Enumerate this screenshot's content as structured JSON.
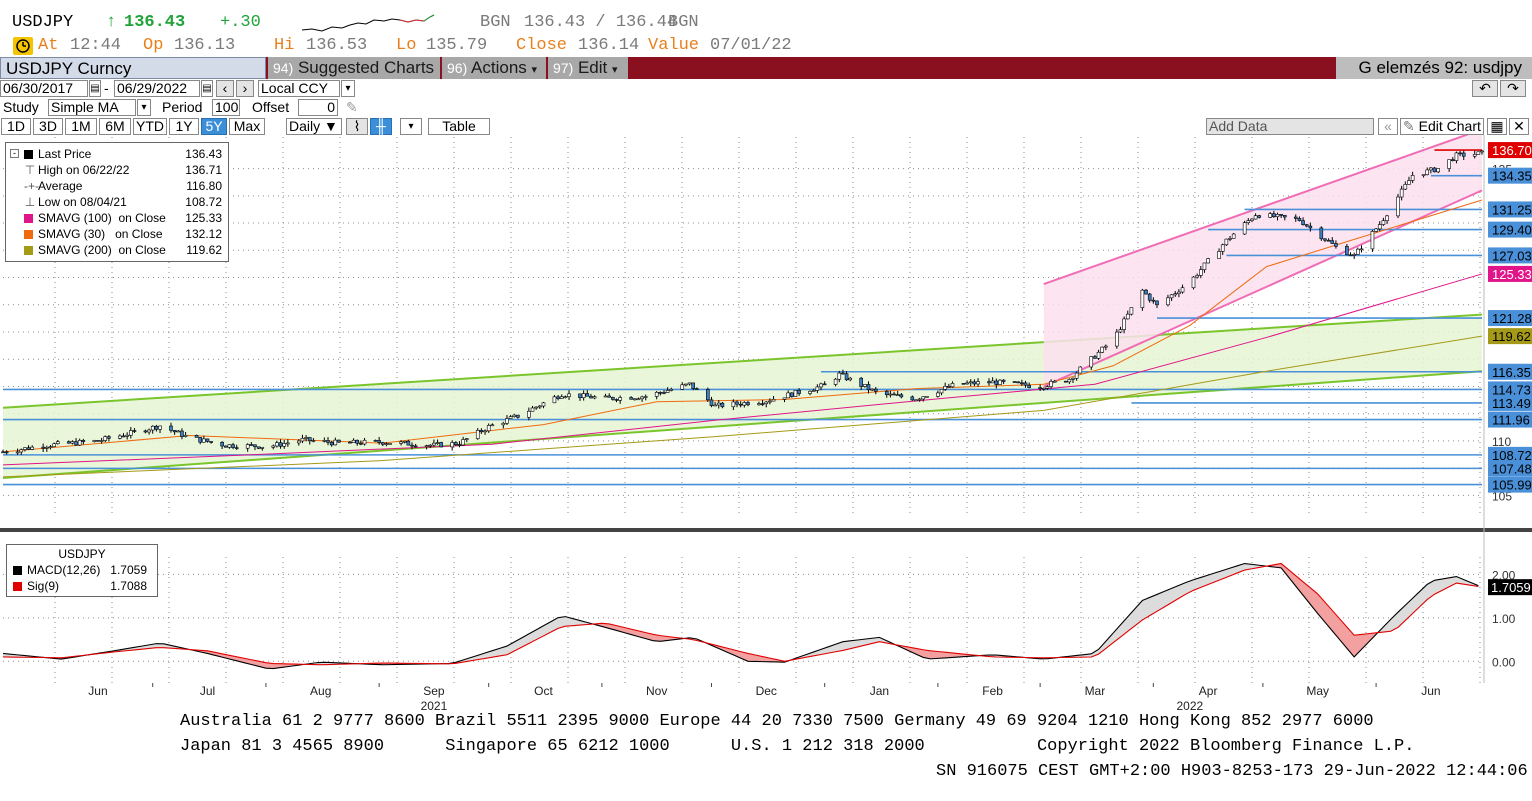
{
  "quote": {
    "ticker": "USDJPY",
    "arrow": "↑",
    "last": "136.43",
    "change": "+.30",
    "bid_label": "BGN",
    "bid_ask": "136.43 / 136.44",
    "ask_label": "BGN",
    "at_label": "At",
    "at_value": "12:44",
    "op_label": "Op",
    "op_value": "136.13",
    "hi_label": "Hi",
    "hi_value": "136.53",
    "lo_label": "Lo",
    "lo_value": "135.79",
    "close_label": "Close",
    "close_value": "136.14",
    "value_label": "Value",
    "value_date": "07/01/22"
  },
  "toolbar": {
    "security": "USDJPY Curncy",
    "suggested_num": "94)",
    "suggested_label": "Suggested Charts",
    "actions_num": "96)",
    "actions_label": "Actions",
    "edit_num": "97)",
    "edit_label": "Edit",
    "title_right": "G elemzés 92: usdjpy"
  },
  "range": {
    "start": "06/30/2017",
    "sep": "-",
    "end": "06/29/2022",
    "currency": "Local CCY"
  },
  "study": {
    "label": "Study",
    "type": "Simple MA",
    "period_label": "Period",
    "period": "100",
    "offset_label": "Offset",
    "offset": "0"
  },
  "periods": {
    "buttons": [
      "1D",
      "3D",
      "1M",
      "6M",
      "YTD",
      "1Y",
      "5Y",
      "Max"
    ],
    "selected": "5Y",
    "frequency": "Daily ▼",
    "table_label": "Table",
    "add_data_placeholder": "Add Data",
    "edit_chart_label": "Edit Chart"
  },
  "legend_price": [
    {
      "label": "Last Price",
      "value": "136.43",
      "color": "#000000",
      "glyph": ""
    },
    {
      "label": "High on 06/22/22",
      "value": "136.71",
      "color": "",
      "glyph": "⊤"
    },
    {
      "label": "Average",
      "value": "116.80",
      "color": "",
      "glyph": "-+-"
    },
    {
      "label": "Low on 08/04/21",
      "value": "108.72",
      "color": "",
      "glyph": "⊥"
    },
    {
      "label": "SMAVG (100)  on Close",
      "value": "125.33",
      "color": "#e0158a",
      "glyph": ""
    },
    {
      "label": "SMAVG (30)   on Close",
      "value": "132.12",
      "color": "#ef6a10",
      "glyph": ""
    },
    {
      "label": "SMAVG (200)  on Close",
      "value": "119.62",
      "color": "#a59a18",
      "glyph": ""
    }
  ],
  "legend_macd": {
    "title": "USDJPY",
    "items": [
      {
        "label": "MACD(12,26)",
        "value": "1.7059",
        "color": "#000000"
      },
      {
        "label": "Sig(9)",
        "value": "1.7088",
        "color": "#e00000"
      }
    ]
  },
  "chart_data": [
    {
      "type": "candlestick",
      "title": "",
      "x_start": "2021-05-20",
      "x_end": "2022-06-29",
      "x_tick_labels": [
        {
          "label": "Jun",
          "date": "2021-06-15"
        },
        {
          "label": "Jul",
          "date": "2021-07-15"
        },
        {
          "label": "Aug",
          "date": "2021-08-15"
        },
        {
          "label": "Sep",
          "date": "2021-09-15"
        },
        {
          "label": "Oct",
          "date": "2021-10-15"
        },
        {
          "label": "Nov",
          "date": "2021-11-15"
        },
        {
          "label": "Dec",
          "date": "2021-12-15"
        },
        {
          "label": "Jan",
          "date": "2022-01-15"
        },
        {
          "label": "Feb",
          "date": "2022-02-15"
        },
        {
          "label": "Mar",
          "date": "2022-03-15"
        },
        {
          "label": "Apr",
          "date": "2022-04-15"
        },
        {
          "label": "May",
          "date": "2022-05-15"
        },
        {
          "label": "Jun",
          "date": "2022-06-15"
        }
      ],
      "year_labels": [
        {
          "label": "2021",
          "date": "2021-09-15"
        },
        {
          "label": "2022",
          "date": "2022-04-10"
        }
      ],
      "ylim": [
        103.2,
        137.9
      ],
      "y_ticks": [
        105,
        110,
        135
      ],
      "grid": true,
      "price_path": [
        [
          "2021-05-20",
          109.0
        ],
        [
          "2021-06-01",
          109.6
        ],
        [
          "2021-06-15",
          110.0
        ],
        [
          "2021-06-25",
          110.8
        ],
        [
          "2021-07-02",
          111.4
        ],
        [
          "2021-07-10",
          110.3
        ],
        [
          "2021-07-20",
          109.6
        ],
        [
          "2021-08-01",
          109.5
        ],
        [
          "2021-08-10",
          110.1
        ],
        [
          "2021-08-20",
          109.8
        ],
        [
          "2021-09-01",
          109.9
        ],
        [
          "2021-09-15",
          109.6
        ],
        [
          "2021-09-22",
          109.8
        ],
        [
          "2021-09-30",
          111.3
        ],
        [
          "2021-10-08",
          112.3
        ],
        [
          "2021-10-20",
          114.3
        ],
        [
          "2021-11-01",
          113.9
        ],
        [
          "2021-11-12",
          114.1
        ],
        [
          "2021-11-24",
          115.2
        ],
        [
          "2021-12-01",
          113.2
        ],
        [
          "2021-12-15",
          113.7
        ],
        [
          "2021-12-31",
          115.1
        ],
        [
          "2022-01-04",
          116.1
        ],
        [
          "2022-01-15",
          114.3
        ],
        [
          "2022-01-25",
          113.9
        ],
        [
          "2022-02-05",
          115.2
        ],
        [
          "2022-02-15",
          115.4
        ],
        [
          "2022-02-28",
          115.0
        ],
        [
          "2022-03-08",
          115.7
        ],
        [
          "2022-03-20",
          119.3
        ],
        [
          "2022-03-28",
          123.8
        ],
        [
          "2022-04-01",
          122.4
        ],
        [
          "2022-04-10",
          124.6
        ],
        [
          "2022-04-20",
          128.4
        ],
        [
          "2022-04-28",
          130.8
        ],
        [
          "2022-05-10",
          130.3
        ],
        [
          "2022-05-20",
          127.8
        ],
        [
          "2022-05-25",
          127.0
        ],
        [
          "2022-06-01",
          129.9
        ],
        [
          "2022-06-10",
          134.4
        ],
        [
          "2022-06-17",
          135.0
        ],
        [
          "2022-06-22",
          136.2
        ],
        [
          "2022-06-29",
          136.4
        ]
      ],
      "series": [
        {
          "name": "SMAVG (30)",
          "values": [
            [
              "2021-05-20",
              109.0
            ],
            [
              "2021-07-10",
              110.5
            ],
            [
              "2021-09-01",
              109.8
            ],
            [
              "2021-10-15",
              111.5
            ],
            [
              "2021-11-15",
              113.6
            ],
            [
              "2021-12-20",
              113.8
            ],
            [
              "2022-01-25",
              114.8
            ],
            [
              "2022-03-01",
              115.2
            ],
            [
              "2022-03-20",
              116.9
            ],
            [
              "2022-04-10",
              120.6
            ],
            [
              "2022-05-01",
              126.0
            ],
            [
              "2022-05-25",
              128.5
            ],
            [
              "2022-06-29",
              132.12
            ]
          ]
        },
        {
          "name": "SMAVG (100)",
          "values": [
            [
              "2021-05-20",
              107.8
            ],
            [
              "2021-08-01",
              108.8
            ],
            [
              "2021-10-01",
              109.7
            ],
            [
              "2021-12-01",
              111.9
            ],
            [
              "2022-02-01",
              113.9
            ],
            [
              "2022-03-15",
              115.2
            ],
            [
              "2022-05-01",
              119.5
            ],
            [
              "2022-06-29",
              125.33
            ]
          ]
        },
        {
          "name": "SMAVG (200)",
          "values": [
            [
              "2021-05-20",
              106.7
            ],
            [
              "2021-09-01",
              108.2
            ],
            [
              "2021-12-01",
              110.4
            ],
            [
              "2022-03-01",
              112.8
            ],
            [
              "2022-05-01",
              116.4
            ],
            [
              "2022-06-29",
              119.62
            ]
          ]
        }
      ],
      "price_labels": [
        {
          "value": "136.70",
          "y": 136.7,
          "bg": "#e00000",
          "fg": "#ffffff"
        },
        {
          "value": "134.35",
          "y": 134.35,
          "bg": "#4a90d9",
          "fg": "#000000"
        },
        {
          "value": "131.25",
          "y": 131.25,
          "bg": "#4a90d9",
          "fg": "#000000"
        },
        {
          "value": "129.40",
          "y": 129.4,
          "bg": "#4a90d9",
          "fg": "#000000"
        },
        {
          "value": "127.03",
          "y": 127.03,
          "bg": "#4a90d9",
          "fg": "#000000"
        },
        {
          "value": "125.33",
          "y": 125.33,
          "bg": "#e0158a",
          "fg": "#ffffff"
        },
        {
          "value": "121.28",
          "y": 121.28,
          "bg": "#4a90d9",
          "fg": "#000000"
        },
        {
          "value": "119.62",
          "y": 119.62,
          "bg": "#a59a18",
          "fg": "#000000"
        },
        {
          "value": "116.35",
          "y": 116.35,
          "bg": "#4a90d9",
          "fg": "#000000"
        },
        {
          "value": "114.73",
          "y": 114.73,
          "bg": "#4a90d9",
          "fg": "#000000"
        },
        {
          "value": "113.49",
          "y": 113.49,
          "bg": "#4a90d9",
          "fg": "#000000"
        },
        {
          "value": "111.96",
          "y": 111.96,
          "bg": "#4a90d9",
          "fg": "#000000"
        },
        {
          "value": "108.72",
          "y": 108.72,
          "bg": "#4a90d9",
          "fg": "#000000"
        },
        {
          "value": "107.48",
          "y": 107.48,
          "bg": "#4a90d9",
          "fg": "#000000"
        },
        {
          "value": "105.99",
          "y": 105.99,
          "bg": "#4a90d9",
          "fg": "#000000"
        }
      ],
      "horizontal_levels": [
        {
          "y": 114.73,
          "from": "2021-05-20",
          "to": "2022-06-29"
        },
        {
          "y": 111.96,
          "from": "2021-05-20",
          "to": "2022-06-29"
        },
        {
          "y": 108.72,
          "from": "2021-05-20",
          "to": "2022-06-29"
        },
        {
          "y": 107.48,
          "from": "2021-05-20",
          "to": "2022-06-29"
        },
        {
          "y": 105.99,
          "from": "2021-05-20",
          "to": "2022-06-29"
        },
        {
          "y": 113.49,
          "from": "2022-03-25",
          "to": "2022-06-29"
        },
        {
          "y": 116.35,
          "from": "2021-12-30",
          "to": "2022-06-29"
        },
        {
          "y": 121.28,
          "from": "2022-04-01",
          "to": "2022-06-29"
        },
        {
          "y": 127.03,
          "from": "2022-04-20",
          "to": "2022-06-29"
        },
        {
          "y": 129.4,
          "from": "2022-04-15",
          "to": "2022-06-29"
        },
        {
          "y": 131.25,
          "from": "2022-04-25",
          "to": "2022-06-29"
        },
        {
          "y": 134.35,
          "from": "2022-06-15",
          "to": "2022-06-29"
        },
        {
          "y": 136.7,
          "from": "2022-06-16",
          "to": "2022-06-29"
        }
      ],
      "green_channel": {
        "upper": [
          [
            "2021-05-20",
            113.05
          ],
          [
            "2022-06-29",
            121.6
          ]
        ],
        "lower": [
          [
            "2021-05-20",
            106.6
          ],
          [
            "2022-06-29",
            116.4
          ]
        ],
        "fill": "#e6f5d2",
        "line": "#7ac52c"
      },
      "pink_channel": {
        "upper": [
          [
            "2022-03-01",
            124.4
          ],
          [
            "2022-06-29",
            138.6
          ]
        ],
        "lower": [
          [
            "2022-03-01",
            115.0
          ],
          [
            "2022-06-29",
            133.0
          ]
        ],
        "fill": "#fbe0ee",
        "line": "#f06cb4"
      }
    },
    {
      "type": "line",
      "title": "USDJPY",
      "ylim": [
        -0.5,
        2.4
      ],
      "y_ticks": [
        {
          "label": "2.00",
          "value": 2.0
        },
        {
          "label": "1.00",
          "value": 1.0
        },
        {
          "label": "0.00",
          "value": 0.0
        }
      ],
      "current_label": {
        "value": "1.7059",
        "y": 1.7059
      },
      "series": [
        {
          "name": "MACD(12,26)",
          "color": "#000000",
          "values": [
            [
              "2021-05-20",
              0.18
            ],
            [
              "2021-06-05",
              0.05
            ],
            [
              "2021-06-20",
              0.25
            ],
            [
              "2021-07-02",
              0.42
            ],
            [
              "2021-07-15",
              0.18
            ],
            [
              "2021-08-01",
              -0.18
            ],
            [
              "2021-08-15",
              -0.02
            ],
            [
              "2021-09-01",
              -0.08
            ],
            [
              "2021-09-20",
              -0.05
            ],
            [
              "2021-10-05",
              0.35
            ],
            [
              "2021-10-20",
              1.05
            ],
            [
              "2021-11-01",
              0.78
            ],
            [
              "2021-11-15",
              0.45
            ],
            [
              "2021-11-25",
              0.55
            ],
            [
              "2021-12-10",
              0.0
            ],
            [
              "2021-12-20",
              -0.02
            ],
            [
              "2022-01-05",
              0.45
            ],
            [
              "2022-01-15",
              0.55
            ],
            [
              "2022-01-28",
              0.05
            ],
            [
              "2022-02-15",
              0.15
            ],
            [
              "2022-03-01",
              0.05
            ],
            [
              "2022-03-15",
              0.18
            ],
            [
              "2022-03-28",
              1.4
            ],
            [
              "2022-04-10",
              1.85
            ],
            [
              "2022-04-25",
              2.25
            ],
            [
              "2022-05-05",
              2.15
            ],
            [
              "2022-05-15",
              1.1
            ],
            [
              "2022-05-25",
              0.1
            ],
            [
              "2022-06-05",
              1.05
            ],
            [
              "2022-06-15",
              1.85
            ],
            [
              "2022-06-22",
              1.95
            ],
            [
              "2022-06-29",
              1.7059
            ]
          ]
        },
        {
          "name": "Sig(9)",
          "color": "#e00000",
          "values": [
            [
              "2021-05-20",
              0.1
            ],
            [
              "2021-06-05",
              0.08
            ],
            [
              "2021-06-20",
              0.22
            ],
            [
              "2021-07-02",
              0.32
            ],
            [
              "2021-07-15",
              0.24
            ],
            [
              "2021-08-01",
              -0.05
            ],
            [
              "2021-08-15",
              -0.08
            ],
            [
              "2021-09-01",
              -0.04
            ],
            [
              "2021-09-20",
              -0.06
            ],
            [
              "2021-10-05",
              0.15
            ],
            [
              "2021-10-20",
              0.8
            ],
            [
              "2021-11-01",
              0.88
            ],
            [
              "2021-11-15",
              0.6
            ],
            [
              "2021-11-25",
              0.5
            ],
            [
              "2021-12-10",
              0.18
            ],
            [
              "2021-12-20",
              0.0
            ],
            [
              "2022-01-05",
              0.25
            ],
            [
              "2022-01-15",
              0.45
            ],
            [
              "2022-01-28",
              0.25
            ],
            [
              "2022-02-15",
              0.1
            ],
            [
              "2022-03-01",
              0.08
            ],
            [
              "2022-03-15",
              0.1
            ],
            [
              "2022-03-28",
              0.95
            ],
            [
              "2022-04-10",
              1.6
            ],
            [
              "2022-04-25",
              2.1
            ],
            [
              "2022-05-05",
              2.25
            ],
            [
              "2022-05-15",
              1.55
            ],
            [
              "2022-05-25",
              0.6
            ],
            [
              "2022-06-05",
              0.7
            ],
            [
              "2022-06-15",
              1.5
            ],
            [
              "2022-06-22",
              1.8
            ],
            [
              "2022-06-29",
              1.7088
            ]
          ]
        }
      ]
    }
  ],
  "footer": {
    "line1": "Australia 61 2 9777 8600 Brazil 5511 2395 9000 Europe 44 20 7330 7500 Germany 49 69 9204 1210 Hong Kong 852 2977 6000",
    "line2": "Japan 81 3 4565 8900      Singapore 65 6212 1000      U.S. 1 212 318 2000           Copyright 2022 Bloomberg Finance L.P.",
    "line3": "SN 916075 CEST GMT+2:00 H903-8253-173 29-Jun-2022 12:44:06"
  },
  "colors": {
    "header_bar": "#8a1020",
    "accent_orange": "#e8801c",
    "up_green": "#21a33a",
    "level_blue": "#4a90d9",
    "selected_blue": "#3b8fd9"
  }
}
